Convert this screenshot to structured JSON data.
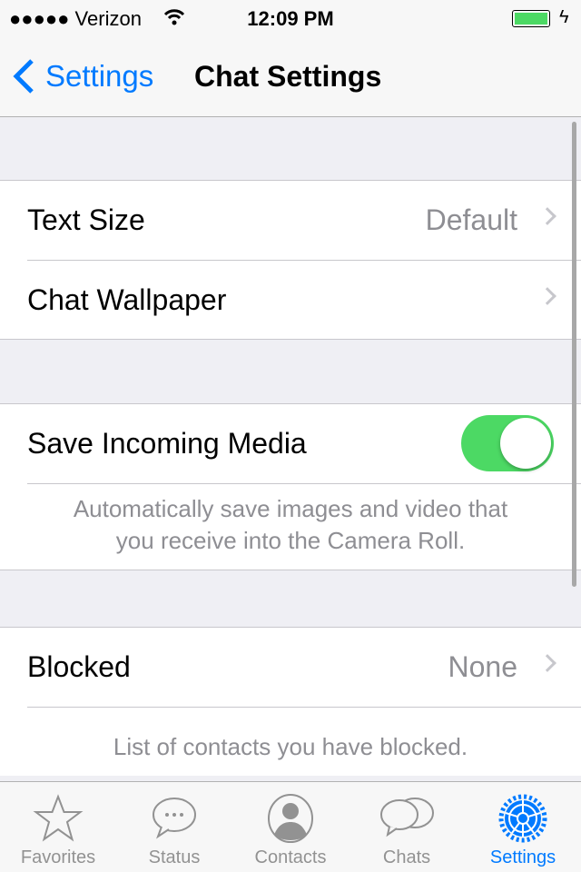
{
  "status": {
    "carrier": "●●●●● Verizon",
    "time": "12:09 PM",
    "battery_percent": 100,
    "charging": true
  },
  "nav": {
    "back_label": "Settings",
    "title": "Chat Settings"
  },
  "sections": [
    {
      "rows": [
        {
          "label": "Text Size",
          "value": "Default"
        },
        {
          "label": "Chat Wallpaper",
          "value": ""
        }
      ]
    },
    {
      "rows": [
        {
          "label": "Save Incoming Media",
          "toggle": true
        }
      ],
      "footer_line1": "Automatically save images and video that",
      "footer_line2": "you receive into the Camera Roll."
    },
    {
      "rows": [
        {
          "label": "Blocked",
          "value": "None"
        }
      ],
      "footer": "List of contacts you have blocked."
    }
  ],
  "tabs": [
    {
      "label": "Favorites",
      "icon": "star-icon"
    },
    {
      "label": "Status",
      "icon": "speech-bubble-icon"
    },
    {
      "label": "Contacts",
      "icon": "person-icon"
    },
    {
      "label": "Chats",
      "icon": "chats-icon"
    },
    {
      "label": "Settings",
      "icon": "gear-icon",
      "active": true
    }
  ],
  "colors": {
    "accent": "#007aff",
    "toggle_on": "#4cd964"
  }
}
